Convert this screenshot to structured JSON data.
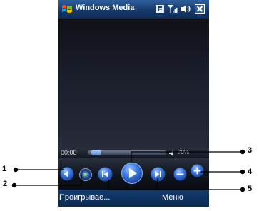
{
  "window": {
    "title": "Windows Media"
  },
  "player": {
    "elapsed": "00:00",
    "volume": "70%",
    "seek_fraction": 0.05
  },
  "softkeys": {
    "left": "Проигрывае...",
    "right": "Меню"
  },
  "callouts": [
    "1",
    "2",
    "3",
    "4",
    "5"
  ],
  "colors": {
    "titlebar": "#163a6b",
    "softkeys": "#0b2a52",
    "button_blue": "#3e7be6"
  }
}
